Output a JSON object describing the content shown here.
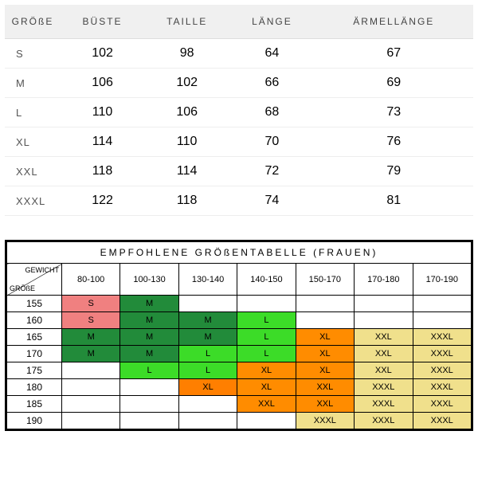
{
  "chart_data": [
    {
      "type": "table",
      "title": "",
      "columns": [
        "GRÖßE",
        "BÜSTE",
        "TAILLE",
        "LÄNGE",
        "ÄRMELLÄNGE"
      ],
      "rows": [
        [
          "S",
          102,
          98,
          64,
          67
        ],
        [
          "M",
          106,
          102,
          66,
          69
        ],
        [
          "L",
          110,
          106,
          68,
          73
        ],
        [
          "XL",
          114,
          110,
          70,
          76
        ],
        [
          "XXL",
          118,
          114,
          72,
          79
        ],
        [
          "XXXL",
          122,
          118,
          74,
          81
        ]
      ]
    },
    {
      "type": "table",
      "title": "EMPFOHLENE GRÖßENTABELLE (FRAUEN)",
      "corner": {
        "top": "GEWICHT",
        "bottom": "GRÖßE"
      },
      "weight_columns": [
        "80-100",
        "100-130",
        "130-140",
        "140-150",
        "150-170",
        "170-180",
        "170-190"
      ],
      "height_rows": [
        155,
        160,
        165,
        170,
        175,
        180,
        185,
        190
      ],
      "cells": [
        [
          [
            "S",
            "pink"
          ],
          [
            "M",
            "dgreen"
          ],
          [
            "",
            ""
          ],
          [
            "",
            ""
          ],
          [
            "",
            ""
          ],
          [
            "",
            ""
          ],
          [
            "",
            ""
          ]
        ],
        [
          [
            "S",
            "pink"
          ],
          [
            "M",
            "dgreen"
          ],
          [
            "M",
            "dgreen"
          ],
          [
            "L",
            "lgreen"
          ],
          [
            "",
            ""
          ],
          [
            "",
            ""
          ],
          [
            "",
            ""
          ]
        ],
        [
          [
            "M",
            "dgreen"
          ],
          [
            "M",
            "dgreen"
          ],
          [
            "M",
            "dgreen"
          ],
          [
            "L",
            "lgreen"
          ],
          [
            "XL",
            "orange"
          ],
          [
            "XXL",
            "tan"
          ],
          [
            "XXXL",
            "tan"
          ]
        ],
        [
          [
            "M",
            "dgreen"
          ],
          [
            "M",
            "dgreen"
          ],
          [
            "L",
            "lgreen"
          ],
          [
            "L",
            "lgreen"
          ],
          [
            "XL",
            "orange"
          ],
          [
            "XXL",
            "tan"
          ],
          [
            "XXXL",
            "tan"
          ]
        ],
        [
          [
            "",
            ""
          ],
          [
            "L",
            "lgreen"
          ],
          [
            "L",
            "lgreen"
          ],
          [
            "XL",
            "orange"
          ],
          [
            "XL",
            "orange"
          ],
          [
            "XXL",
            "tan"
          ],
          [
            "XXXL",
            "tan"
          ]
        ],
        [
          [
            "",
            ""
          ],
          [
            "",
            ""
          ],
          [
            "XL",
            "dorange"
          ],
          [
            "XL",
            "orange"
          ],
          [
            "XXL",
            "orange"
          ],
          [
            "XXXL",
            "tan"
          ],
          [
            "XXXL",
            "tan"
          ]
        ],
        [
          [
            "",
            ""
          ],
          [
            "",
            ""
          ],
          [
            "",
            ""
          ],
          [
            "XXL",
            "orange"
          ],
          [
            "XXL",
            "orange"
          ],
          [
            "XXXL",
            "tan"
          ],
          [
            "XXXL",
            "tan"
          ]
        ],
        [
          [
            "",
            ""
          ],
          [
            "",
            ""
          ],
          [
            "",
            ""
          ],
          [
            "",
            ""
          ],
          [
            "XXXL",
            "tan"
          ],
          [
            "XXXL",
            "tan"
          ],
          [
            "XXXL",
            "tan"
          ]
        ]
      ]
    }
  ]
}
